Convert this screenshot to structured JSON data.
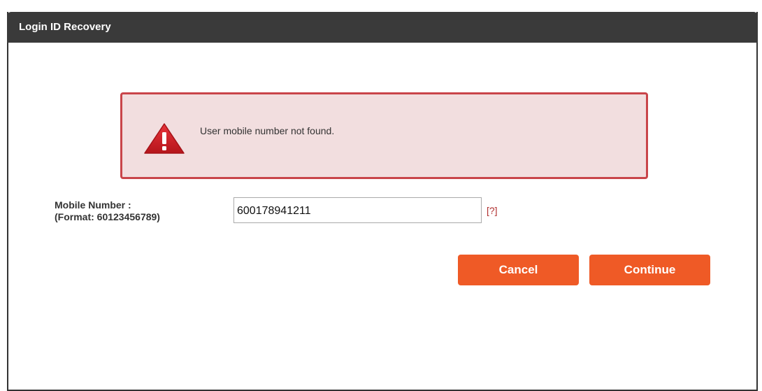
{
  "header": {
    "title": "Login ID Recovery"
  },
  "alert": {
    "icon": "warning-triangle-icon",
    "message": "User mobile number not found.",
    "background_color": "#f2dedf",
    "border_color": "#c9454a"
  },
  "form": {
    "mobile_label": "Mobile Number :",
    "mobile_format": "(Format: 60123456789)",
    "mobile_value": "600178941211",
    "help_link": "[?]"
  },
  "buttons": {
    "cancel_label": "Cancel",
    "continue_label": "Continue",
    "color": "#ef5a26"
  }
}
